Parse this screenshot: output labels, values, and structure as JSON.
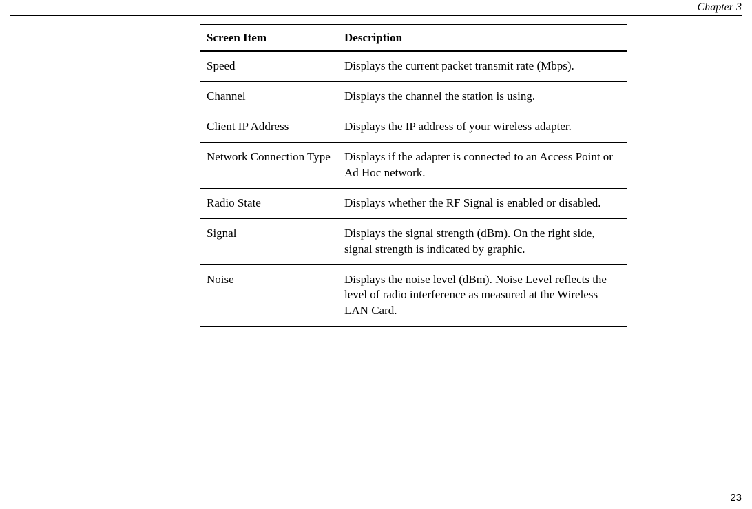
{
  "chapter": "Chapter 3",
  "page_number": "23",
  "table": {
    "headers": {
      "col1": "Screen Item",
      "col2": "Description"
    },
    "rows": [
      {
        "item": "Speed",
        "desc": "Displays the current packet transmit rate (Mbps)."
      },
      {
        "item": "Channel",
        "desc": "Displays the channel the station is using."
      },
      {
        "item": "Client IP Address",
        "desc": "Displays the IP address of your wireless adapter."
      },
      {
        "item": "Network Connection Type",
        "desc": "Displays if the adapter is connected to an Access Point or Ad Hoc network."
      },
      {
        "item": "Radio State",
        "desc": "Displays whether the RF Signal is enabled or disabled."
      },
      {
        "item": "Signal",
        "desc": "Displays the signal strength (dBm). On the right side, signal strength is indicated by graphic."
      },
      {
        "item": "Noise",
        "desc": "Displays the noise level (dBm). Noise Level reflects the level of radio interference as measured at the Wireless LAN Card."
      }
    ]
  }
}
